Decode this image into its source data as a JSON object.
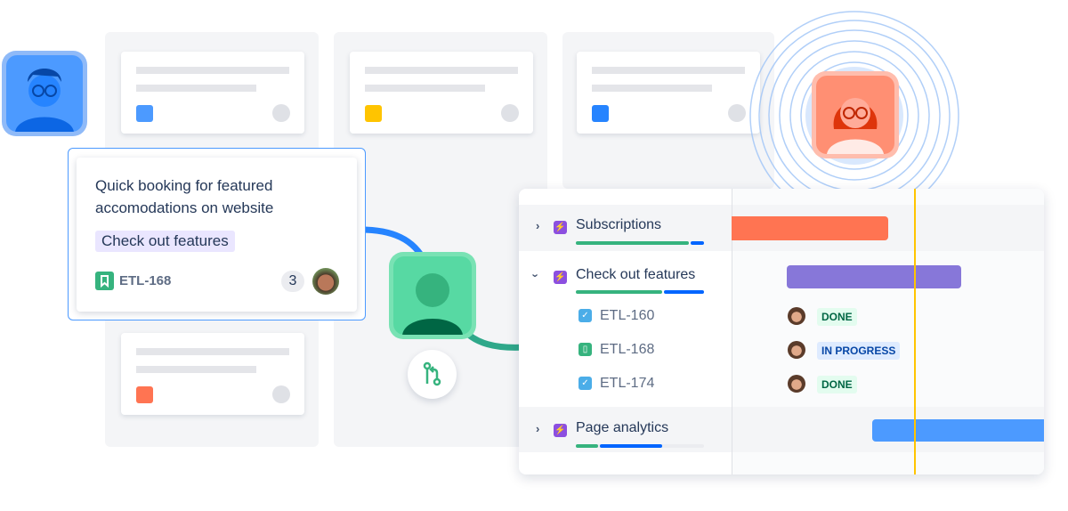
{
  "board": {
    "placeholder_colors": [
      "#4c9aff",
      "#ffc400",
      "#2684ff",
      "#ff7452"
    ]
  },
  "highlight_card": {
    "title_line1": "Quick booking for featured",
    "title_line2": "accomodations on website",
    "epic_label": "Check out features",
    "issue_key": "ETL-168",
    "issue_icon": "story-bookmark-icon",
    "comment_count": "3"
  },
  "git_icon": "pull-request-icon",
  "timeline": {
    "epics": [
      {
        "name": "Subscriptions",
        "expanded": false,
        "bar_color": "#ff7452",
        "progress_done": 0.85,
        "progress_in_progress": 0.12
      },
      {
        "name": "Check out features",
        "expanded": true,
        "bar_color": "#8777d9",
        "progress_done": 0.68,
        "progress_in_progress": 0.32
      },
      {
        "name": "Page analytics",
        "expanded": false,
        "bar_color": "#4c9aff",
        "progress_done": 0.19,
        "progress_in_progress": 0.5
      }
    ],
    "issues": [
      {
        "key": "ETL-160",
        "icon": "task-check-icon",
        "status": "DONE"
      },
      {
        "key": "ETL-168",
        "icon": "story-bookmark-icon",
        "status": "IN PROGRESS"
      },
      {
        "key": "ETL-174",
        "icon": "task-check-icon",
        "status": "DONE"
      }
    ],
    "today_marker_color": "#ffc400"
  }
}
